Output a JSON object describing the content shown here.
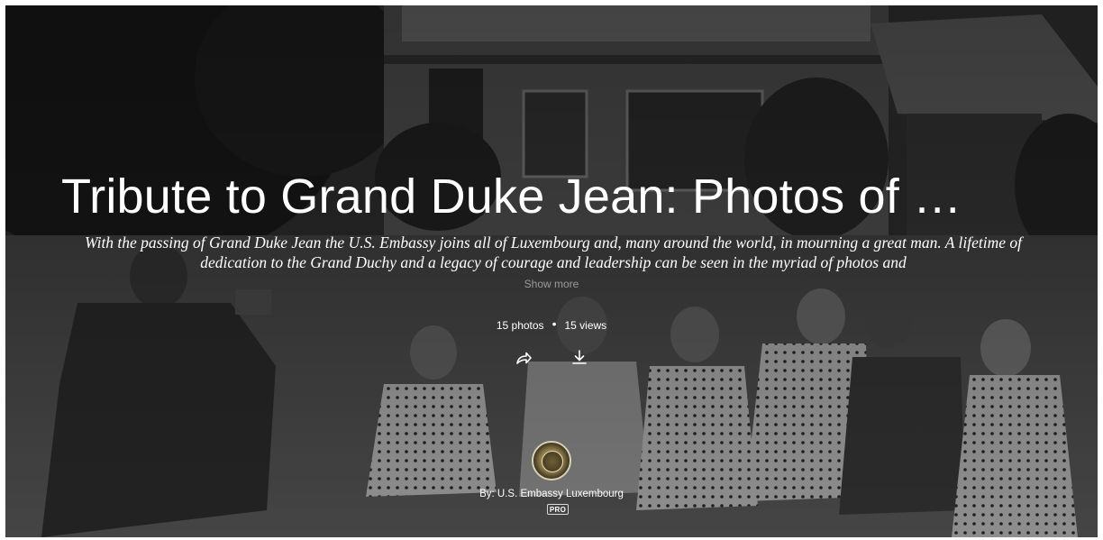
{
  "album": {
    "title": "Tribute to Grand Duke Jean: Photos of …",
    "description": "With the passing of Grand Duke Jean the U.S. Embassy joins all of Luxembourg and, many around the world, in mourning a great man. A lifetime of dedication to the Grand Duchy and a legacy of courage and leadership can be seen in the myriad of photos and",
    "show_more_label": "Show more",
    "photos_count": "15 photos",
    "separator": "•",
    "views_count": "15 views",
    "byline_prefix": "By: ",
    "owner_name": "U.S. Embassy Luxembourg",
    "pro_badge": "PRO"
  },
  "icons": {
    "share": "share-icon",
    "download": "download-icon",
    "avatar": "embassy-seal-avatar"
  }
}
